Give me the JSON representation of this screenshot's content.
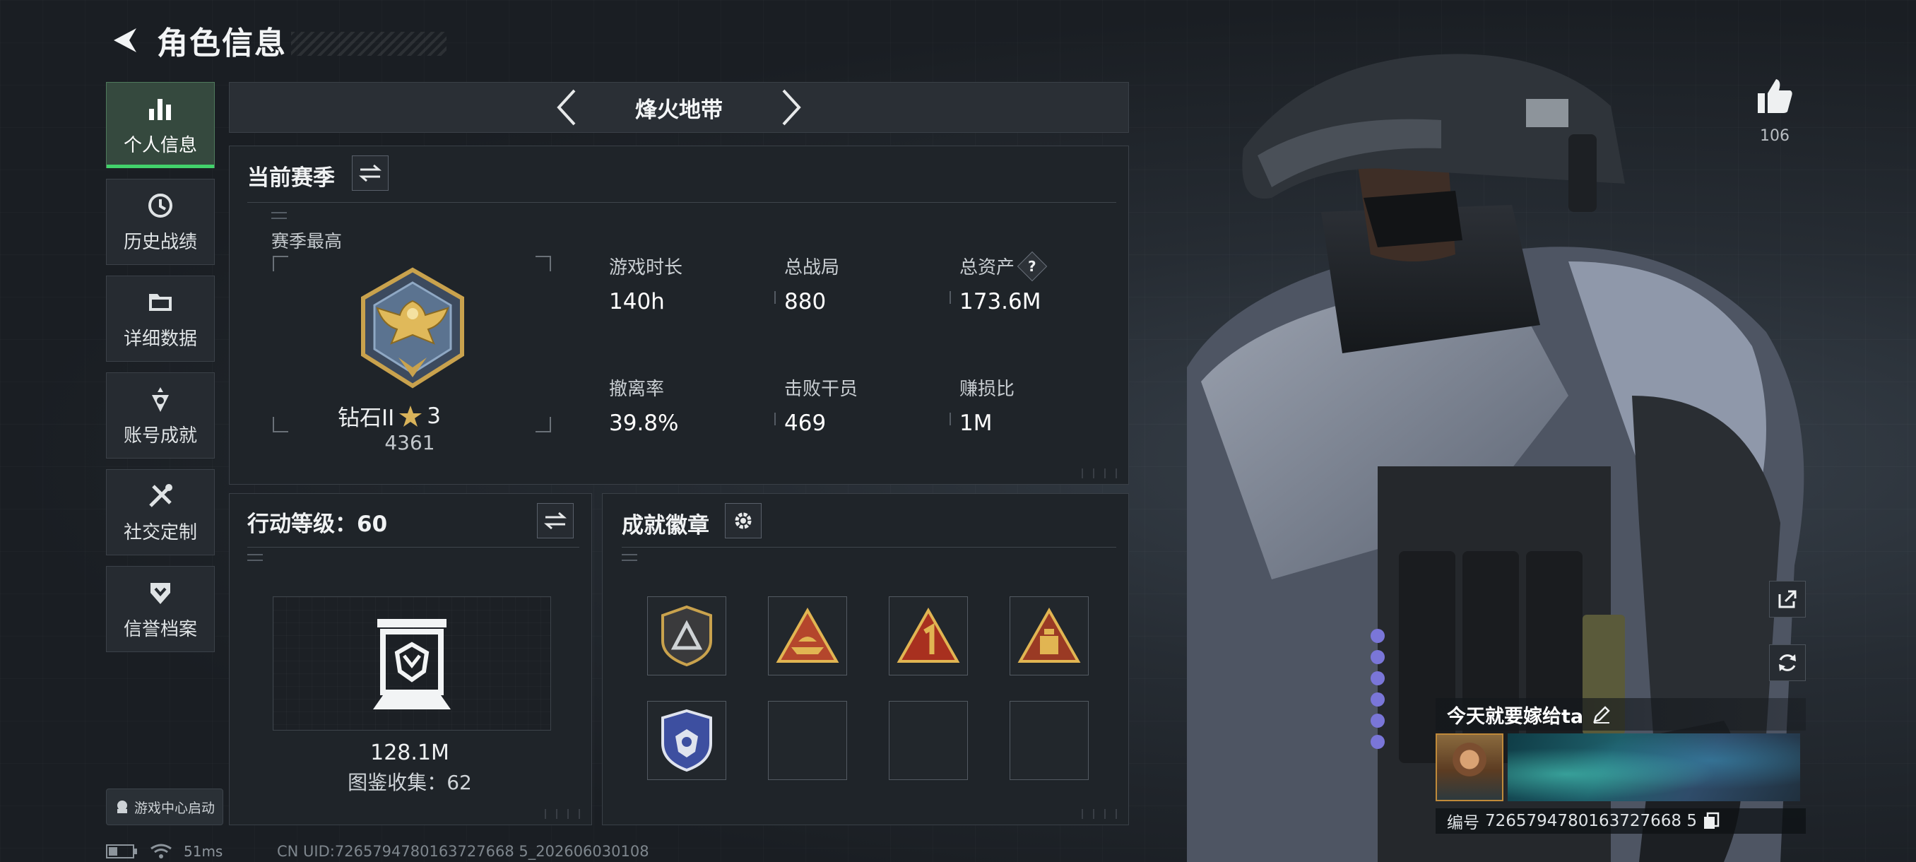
{
  "header": {
    "title": "角色信息"
  },
  "sidebar": {
    "items": [
      {
        "label": "个人信息",
        "icon": "bar-chart-icon",
        "active": true
      },
      {
        "label": "历史战绩",
        "icon": "history-icon",
        "active": false
      },
      {
        "label": "详细数据",
        "icon": "folder-icon",
        "active": false
      },
      {
        "label": "账号成就",
        "icon": "achievement-icon",
        "active": false
      },
      {
        "label": "社交定制",
        "icon": "tools-icon",
        "active": false
      },
      {
        "label": "信誉档案",
        "icon": "shield-chevron-icon",
        "active": false
      }
    ],
    "launch_label": "游戏中心启动"
  },
  "status": {
    "ping": "51ms",
    "uid": "CN UID:7265794780163727668 5_202606030108"
  },
  "map_bar": {
    "name": "烽火地带"
  },
  "season": {
    "title": "当前赛季",
    "subtitle": "赛季最高",
    "rank_name": "钻石II",
    "rank_stars": "3",
    "rank_score": "4361",
    "stats": [
      {
        "label": "游戏时长",
        "value": "140h"
      },
      {
        "label": "总战局",
        "value": "880"
      },
      {
        "label": "总资产",
        "value": "173.6M",
        "help": "?"
      },
      {
        "label": "撤离率",
        "value": "39.8%"
      },
      {
        "label": "击败干员",
        "value": "469"
      },
      {
        "label": "赚损比",
        "value": "1M"
      }
    ]
  },
  "level": {
    "title": "行动等级：60",
    "value": "128.1M",
    "collection_label": "图鉴收集：",
    "collection_value": "62"
  },
  "badges": {
    "title": "成就徽章",
    "slots": [
      {
        "icon": "triangle-shield-badge-icon",
        "filled": true
      },
      {
        "icon": "boat-triangle-badge-icon",
        "filled": true
      },
      {
        "icon": "number-one-badge-icon",
        "filled": true
      },
      {
        "icon": "bottle-triangle-badge-icon",
        "filled": true
      },
      {
        "icon": "blue-shield-badge-icon",
        "filled": true
      },
      {
        "filled": false
      },
      {
        "filled": false
      },
      {
        "filled": false
      }
    ]
  },
  "profile": {
    "likes": "106",
    "nickname": "今天就要嫁给ta",
    "id_label": "编号",
    "id_value": "7265794780163727668 5"
  },
  "colors": {
    "accent_green": "#42d26b",
    "panel_bg": "#1f2429",
    "border": "#3a4047"
  }
}
